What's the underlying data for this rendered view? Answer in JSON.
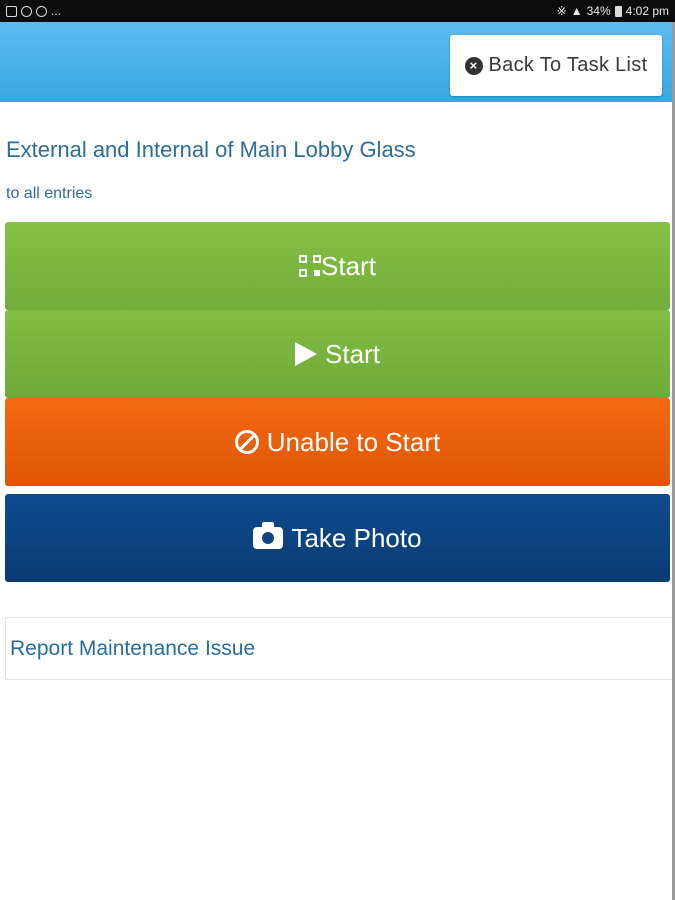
{
  "status_bar": {
    "left_icons": [
      "gallery-icon",
      "link-icon",
      "settings-icon"
    ],
    "ellipsis": "...",
    "battery": "34%",
    "time": "4:02 pm"
  },
  "header": {
    "back_label": "Back To Task List"
  },
  "task": {
    "title": "External and Internal of Main Lobby Glass",
    "subtitle": "to all entries"
  },
  "actions": {
    "qr_start": "Start",
    "start": "Start",
    "unable": "Unable to Start",
    "photo": "Take Photo"
  },
  "maintenance": {
    "label": "Report Maintenance Issue"
  },
  "colors": {
    "header": "#46aee8",
    "start_green": "#7ab73f",
    "unable_orange": "#ec5f0a",
    "photo_blue": "#0c4482",
    "link_text": "#2b6e9a"
  }
}
